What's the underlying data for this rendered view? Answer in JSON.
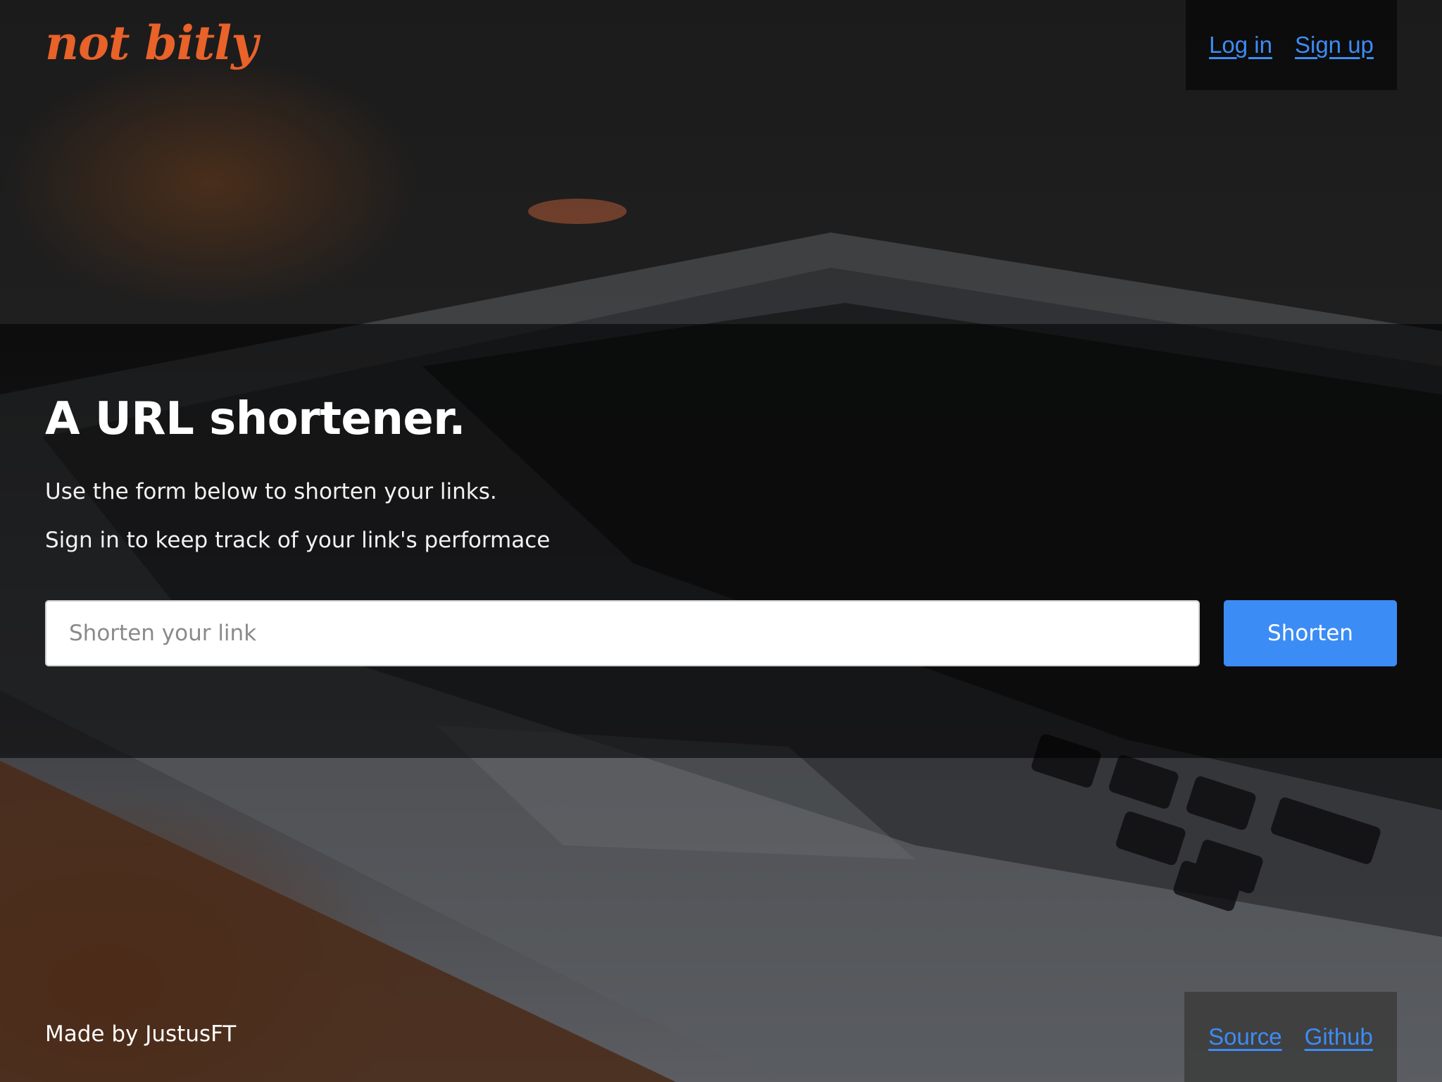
{
  "header": {
    "logo_text": "not bitly",
    "login_label": "Log in",
    "signup_label": "Sign up"
  },
  "hero": {
    "title": "A URL shortener.",
    "line1": "Use the form below to shorten your links.",
    "line2": "Sign in to keep track of your link's performace",
    "input_placeholder": "Shorten your link",
    "input_value": "",
    "button_label": "Shorten"
  },
  "footer": {
    "credit": "Made by JustusFT",
    "source_label": "Source",
    "github_label": "Github"
  },
  "colors": {
    "brand": "#e8622a",
    "link": "#3c8cf5",
    "button": "#3c8cf5"
  },
  "background_image": "blurred-laptop-keyboard-photo"
}
